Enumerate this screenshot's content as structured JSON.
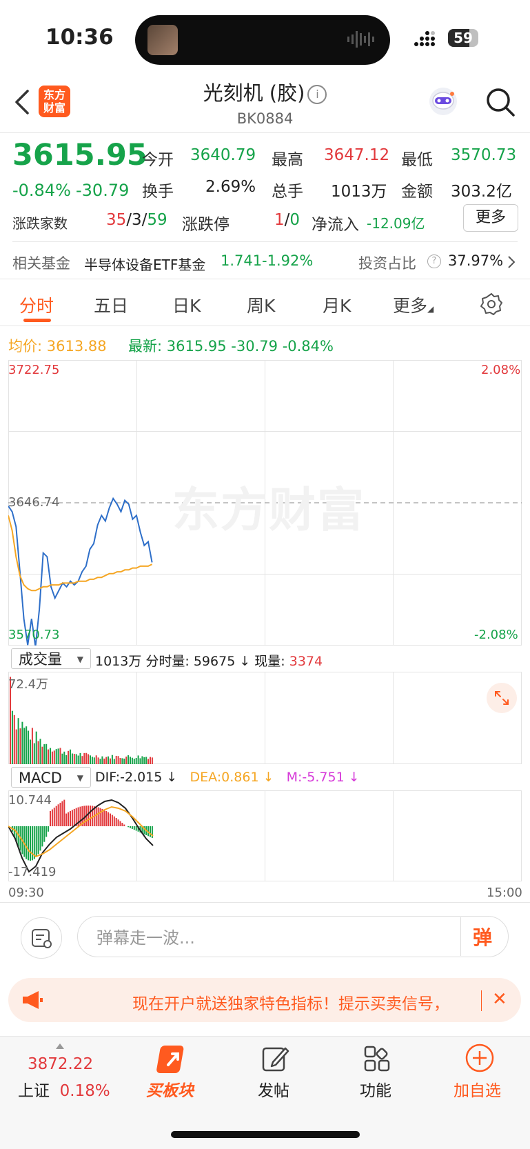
{
  "status_bar": {
    "time": "10:36",
    "battery": "59"
  },
  "header": {
    "logo_line1": "东方",
    "logo_line2": "财富",
    "title": "光刻机 (胶)",
    "info_icon": "i",
    "code": "BK0884"
  },
  "quote": {
    "price": "3615.95",
    "change_pct": "-0.84%",
    "change": "-30.79",
    "open_label": "今开",
    "open": "3640.79",
    "high_label": "最高",
    "high": "3647.12",
    "low_label": "最低",
    "low": "3570.73",
    "turnover_label": "换手",
    "turnover": "2.69%",
    "volume_label": "总手",
    "volume": "1013万",
    "amount_label": "金额",
    "amount": "303.2亿",
    "breadth_label": "涨跌家数",
    "breadth_up": "35",
    "breadth_flat": "3",
    "breadth_down": "59",
    "limit_label": "涨跌停",
    "limit_up": "1",
    "limit_down": "0",
    "netflow_label": "净流入",
    "netflow": "-12.09亿",
    "more_label": "更多"
  },
  "fund_row": {
    "label": "相关基金",
    "fund_name": "半导体设备ETF基金",
    "fund_price": "1.741",
    "fund_change": "-1.92%",
    "ratio_label": "投资占比",
    "ratio_value": "37.97%"
  },
  "tabs": [
    "分时",
    "五日",
    "日K",
    "周K",
    "月K",
    "更多"
  ],
  "info_line": {
    "avg_label": "均价:",
    "avg": "3613.88",
    "latest_label": "最新:",
    "latest": "3615.95",
    "change": "-30.79",
    "change_pct": "-0.84%"
  },
  "intraday": {
    "top_price": "3722.75",
    "top_pct": "2.08%",
    "ref_price": "3646.74",
    "bottom_price": "3570.73",
    "bottom_pct": "-2.08%",
    "watermark": "东方财富"
  },
  "volume_panel": {
    "selector": "成交量",
    "summary_total": "1013万",
    "summary_rest": "分时量: 59675 ↓ 现量:",
    "current": "3374",
    "max": "72.4万"
  },
  "macd_panel": {
    "selector": "MACD",
    "dif": "DIF:-2.015 ↓",
    "dea": "DEA:0.861 ↓",
    "m": "M:-5.751 ↓",
    "max": "10.744",
    "min": "-17.419",
    "time_start": "09:30",
    "time_end": "15:00"
  },
  "comment": {
    "placeholder": "弹幕走一波...",
    "button": "弹"
  },
  "banner": {
    "text": "现在开户就送独家特色指标！提示买卖信号，",
    "close": "✕"
  },
  "bottom_nav": {
    "index_value": "3872.22",
    "index_name": "上证",
    "index_change": "0.18%",
    "buy": "买板块",
    "post": "发帖",
    "functions": "功能",
    "add": "加自选"
  },
  "colors": {
    "accent": "#ff5a1f",
    "up": "#e2393c",
    "down": "#16a34a",
    "avg_line": "#f5a623",
    "price_line": "#2e6fc9"
  },
  "chart_data": {
    "type": "line",
    "title": "",
    "ylim": [
      3570.73,
      3722.75
    ],
    "reference": 3646.74,
    "series": [
      {
        "name": "",
        "values": [
          3645,
          3642,
          3634,
          3610,
          3585,
          3571,
          3585,
          3570,
          3590,
          3620,
          3618,
          3602,
          3596,
          3600,
          3604,
          3602,
          3605,
          3603,
          3605,
          3610,
          3613,
          3622,
          3625,
          3635,
          3640,
          3637,
          3644,
          3649,
          3646,
          3642,
          3648,
          3646,
          3638,
          3640,
          3631,
          3624,
          3626,
          3615
        ]
      },
      {
        "name": "",
        "values": [
          3640,
          3632,
          3618,
          3608,
          3603,
          3601,
          3600,
          3600,
          3601,
          3602,
          3602,
          3603,
          3603,
          3603,
          3604,
          3604,
          3604,
          3604,
          3605,
          3605,
          3605,
          3606,
          3606,
          3607,
          3607,
          3608,
          3609,
          3609,
          3610,
          3610,
          3611,
          3611,
          3612,
          3612,
          3613,
          3613,
          3613,
          3614
        ]
      }
    ]
  }
}
